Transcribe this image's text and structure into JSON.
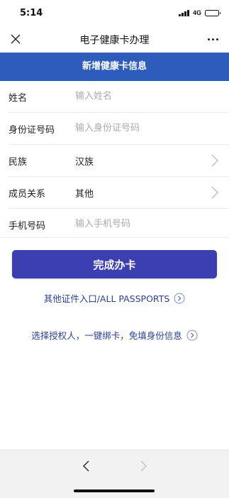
{
  "status_bar": {
    "time": "5:14",
    "network": "4G"
  },
  "nav": {
    "title": "电子健康卡办理"
  },
  "banner": {
    "title": "新增健康卡信息"
  },
  "form": {
    "name": {
      "label": "姓名",
      "placeholder": "输入姓名"
    },
    "id_number": {
      "label": "身份证号码",
      "placeholder": "输入身份证号码"
    },
    "ethnicity": {
      "label": "民族",
      "value": "汉族"
    },
    "relation": {
      "label": "成员关系",
      "value": "其他"
    },
    "phone": {
      "label": "手机号码",
      "placeholder": "输入手机号码"
    }
  },
  "actions": {
    "submit_label": "完成办卡",
    "other_docs_label": "其他证件入口/ALL PASSPORTS",
    "authorize_label": "选择授权人，一键绑卡，免填身份信息"
  },
  "colors": {
    "banner": "#2d5cbc",
    "primary_button": "#3b3faf",
    "link": "#2a3f95"
  },
  "icons": {
    "close": "close-icon",
    "more": "more-icon",
    "chevron": "chevron-right-icon",
    "circle_arrow": "circle-arrow-right-icon",
    "back": "back-arrow-icon",
    "forward": "forward-arrow-icon"
  }
}
